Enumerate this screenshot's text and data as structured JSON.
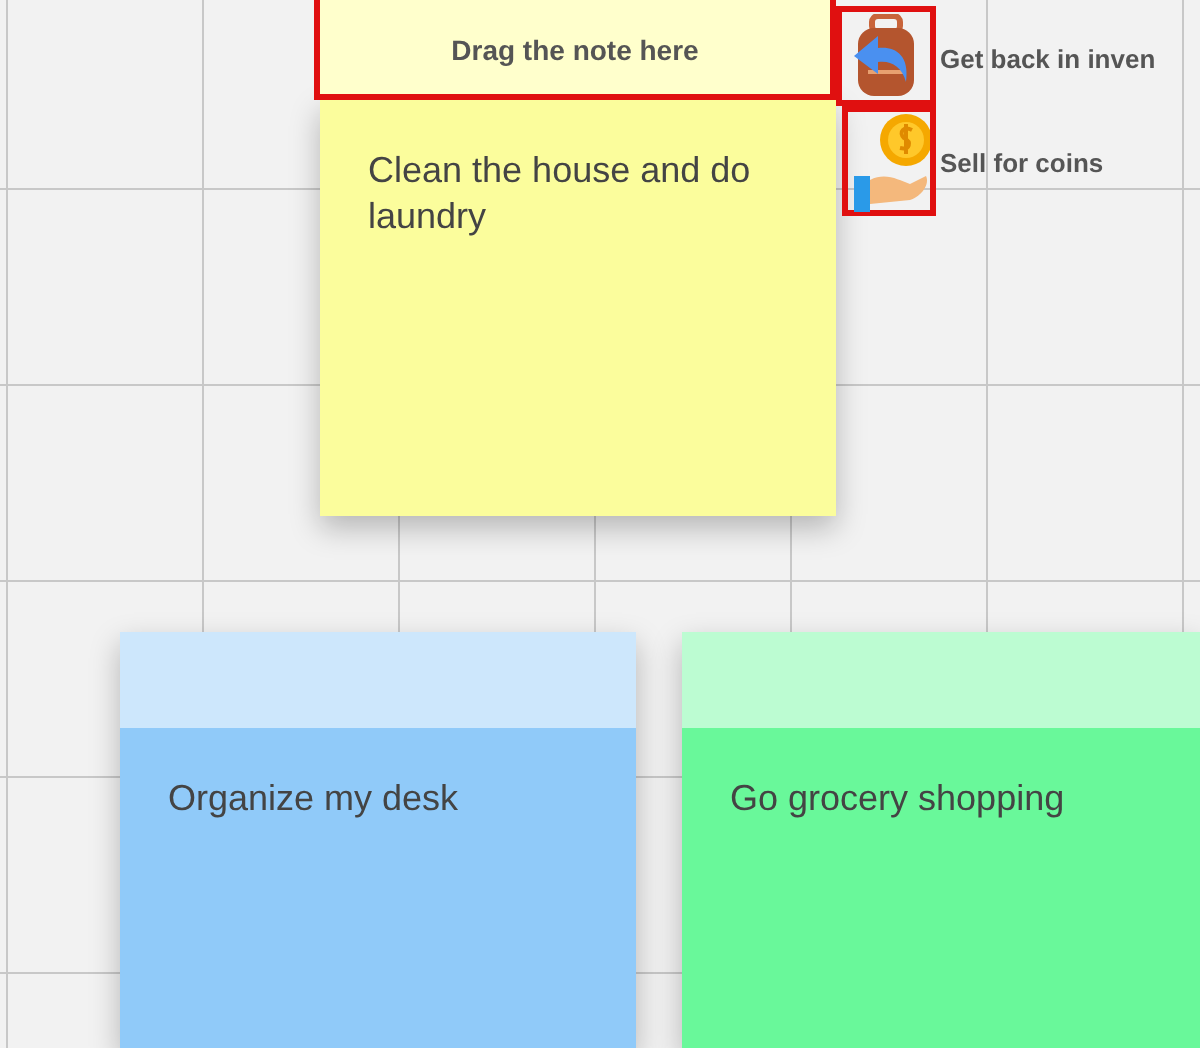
{
  "drop_zone": {
    "label": "Drag the note here"
  },
  "actions": [
    {
      "kind": "inventory",
      "label": "Get back in inven"
    },
    {
      "kind": "sell",
      "label": "Sell for coins"
    }
  ],
  "notes": [
    {
      "text": "Clean the house and do laundry",
      "color": "#fbfd9c"
    },
    {
      "text": "Organize my desk",
      "color": "#90caf9"
    },
    {
      "text": "Go grocery shopping",
      "color": "#69f89a"
    }
  ]
}
